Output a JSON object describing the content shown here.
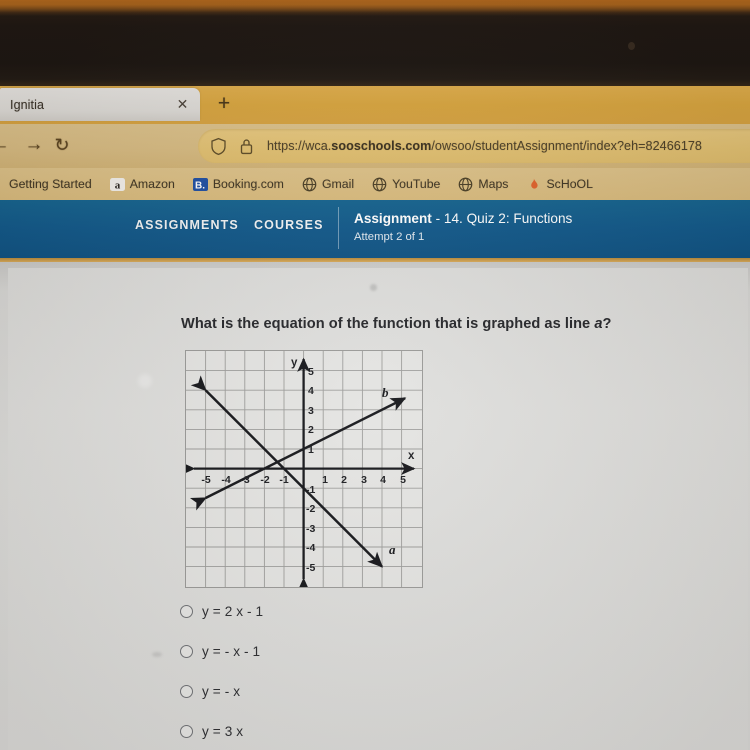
{
  "browser": {
    "tab": {
      "title": "Ignitia",
      "close_icon": "close-icon"
    },
    "new_tab_icon": "plus-icon",
    "nav": {
      "back_icon": "arrow-left-icon",
      "forward_icon": "arrow-right-icon",
      "reload_icon": "reload-icon"
    },
    "url": {
      "shield_icon": "shield-icon",
      "lock_icon": "lock-icon",
      "prefix": "https://wca.",
      "domain": "sooschools.com",
      "path": "/owsoo/studentAssignment/index?eh=82466178"
    },
    "bookmarks": [
      {
        "label": "Getting Started",
        "icon": "none"
      },
      {
        "label": "Amazon",
        "icon": "amazon-icon"
      },
      {
        "label": "Booking.com",
        "icon": "booking-icon"
      },
      {
        "label": "Gmail",
        "icon": "globe-icon"
      },
      {
        "label": "YouTube",
        "icon": "globe-icon"
      },
      {
        "label": "Maps",
        "icon": "globe-icon"
      },
      {
        "label": "ScHoOL",
        "icon": "flame-icon"
      }
    ]
  },
  "appbar": {
    "assignments": "ASSIGNMENTS",
    "courses": "COURSES",
    "title_bold": "Assignment",
    "title_rest": " - 14. Quiz 2: Functions",
    "subtitle": "Attempt 2 of 1",
    "color": "#10588a"
  },
  "question": {
    "text_before": "What is the equation of the function that is graphed as line ",
    "italic": "a",
    "text_after": "?"
  },
  "chart_data": {
    "type": "line",
    "title": "",
    "xlabel": "x",
    "ylabel": "y",
    "xlim": [
      -6,
      6
    ],
    "ylim": [
      -6,
      6
    ],
    "grid": true,
    "x_ticks": [
      -5,
      -4,
      -3,
      -2,
      -1,
      1,
      2,
      3,
      4,
      5
    ],
    "y_ticks": [
      5,
      4,
      3,
      2,
      1,
      -1,
      -2,
      -3,
      -4,
      -5
    ],
    "series": [
      {
        "name": "a",
        "label": "a",
        "slope": -1,
        "intercept": -1,
        "from": [
          -5,
          4
        ],
        "to": [
          4,
          -5
        ],
        "label_at": [
          4.6,
          -4.2
        ]
      },
      {
        "name": "b",
        "label": "b",
        "slope": 0.5,
        "intercept": 1,
        "from": [
          -5,
          -1.5
        ],
        "to": [
          5.2,
          3.6
        ],
        "label_at": [
          4.3,
          3.9
        ]
      }
    ]
  },
  "options": [
    {
      "label": "y = 2 x - 1",
      "selected": false
    },
    {
      "label": "y = - x - 1",
      "selected": false
    },
    {
      "label": "y = - x",
      "selected": false
    },
    {
      "label": "y = 3 x",
      "selected": false
    }
  ]
}
